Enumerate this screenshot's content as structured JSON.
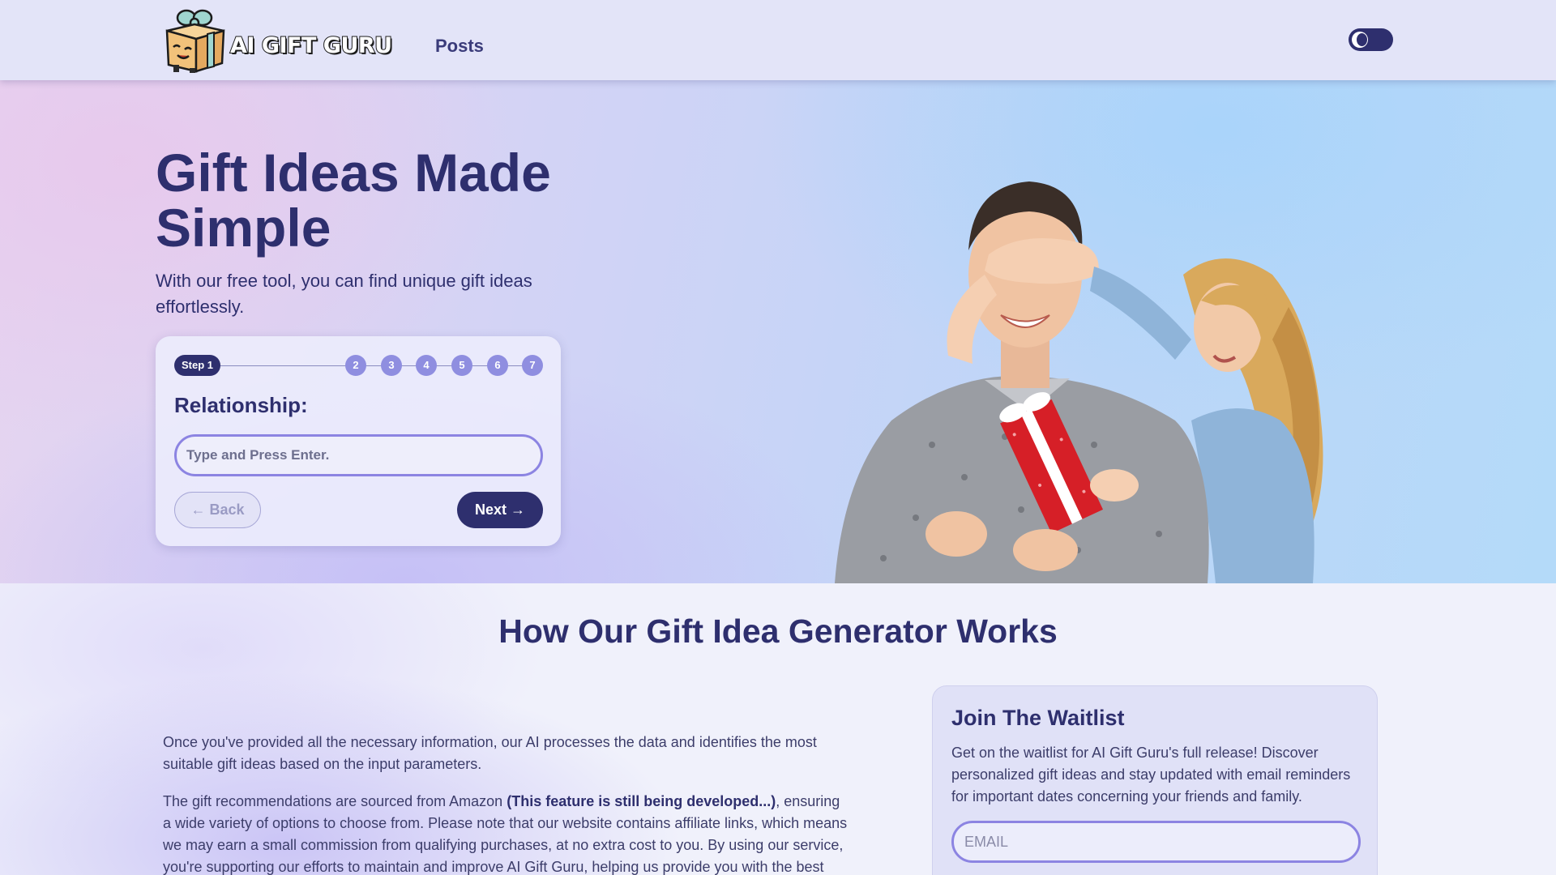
{
  "header": {
    "logo_text": "AI GIFT GURU",
    "nav_posts": "Posts"
  },
  "hero": {
    "title": "Gift Ideas Made Simple",
    "subtitle": "With our free tool, you can find unique gift ideas effortlessly."
  },
  "wizard": {
    "current_step": "Step 1",
    "steps": [
      "2",
      "3",
      "4",
      "5",
      "6",
      "7"
    ],
    "field_label": "Relationship:",
    "input_placeholder": "Type and Press Enter.",
    "input_value": "",
    "back_label": "← Back",
    "next_label": "Next →"
  },
  "section": {
    "title": "How Our Gift Idea Generator Works",
    "para1": "Once you've provided all the necessary information, our AI processes the data and identifies the most suitable gift ideas based on the input parameters.",
    "para2_start": "The gift recommendations are sourced from Amazon ",
    "para2_bold": "(This feature is still being developed...)",
    "para2_rest": ", ensuring a wide variety of options to choose from. Please note that our website contains affiliate links, which means we may earn a small commission from qualifying purchases, at no extra cost to you. By using our service, you're supporting our efforts to maintain and improve AI Gift Guru, helping us provide you with the best"
  },
  "waitlist": {
    "title": "Join The Waitlist",
    "text": "Get on the waitlist for AI Gift Guru's full release! Discover personalized gift ideas and stay updated with email reminders for important dates concerning your friends and family.",
    "email_placeholder": "EMAIL"
  },
  "colors": {
    "primary": "#2e2f6e",
    "step_dot": "#8f8ee0",
    "input_border": "#8c84e2"
  },
  "icons": {
    "logo": "gift-box-mascot-icon",
    "theme_toggle": "moon-icon"
  }
}
